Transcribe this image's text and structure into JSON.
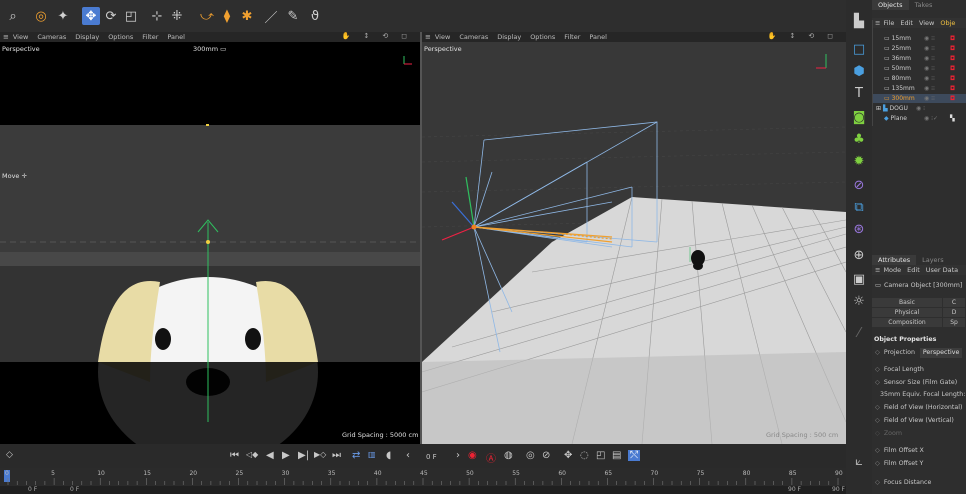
{
  "viewport_menu": [
    "View",
    "Cameras",
    "Display",
    "Options",
    "Filter",
    "Panel"
  ],
  "left_viewport": {
    "label": "Perspective",
    "camera": "300mm",
    "move_label": "Move",
    "grid_spacing": "Grid Spacing : 5000 cm"
  },
  "right_viewport": {
    "label": "Perspective",
    "grid_spacing": "Grid Spacing : 500 cm"
  },
  "objects_panel": {
    "tabs": [
      "Objects",
      "Takes"
    ],
    "menu": [
      "File",
      "Edit",
      "View",
      "Obje"
    ],
    "items": [
      "15mm",
      "25mm",
      "36mm",
      "50mm",
      "80mm",
      "135mm",
      "300mm",
      "DOGU",
      "Plane"
    ]
  },
  "attributes_panel": {
    "tabs": [
      "Attributes",
      "Layers"
    ],
    "menu": [
      "Mode",
      "Edit",
      "User Data"
    ],
    "object_title": "Camera Object [300mm]",
    "tab_grid": [
      [
        "Basic",
        "C"
      ],
      [
        "Physical",
        "D"
      ],
      [
        "Composition",
        "Sp"
      ]
    ],
    "section": "Object Properties",
    "projection_label": "Projection",
    "projection_value": "Perspective",
    "fields": [
      "Focal Length",
      "Sensor Size (Film Gate)",
      "35mm Equiv. Focal Length:",
      "Field of View (Horizontal)",
      "Field of View (Vertical)",
      "Zoom",
      "Film Offset X",
      "Film Offset Y",
      "Focus Distance"
    ]
  },
  "playback": {
    "current_frame": "0 F"
  },
  "timeline": {
    "ticks": [
      "0",
      "5",
      "10",
      "15",
      "20",
      "25",
      "30",
      "35",
      "40",
      "45",
      "50",
      "55",
      "60",
      "65",
      "70",
      "75",
      "80",
      "85",
      "90"
    ],
    "start": "0 F",
    "start2": "0 F",
    "end": "90 F",
    "end2": "90 F"
  },
  "colors": {
    "accent": "#4a7bd1",
    "selection": "#4a7bd1",
    "camera_lines": "#8fb8e6",
    "cube_icon": "#4a9fe0",
    "red": "#dd2233"
  }
}
